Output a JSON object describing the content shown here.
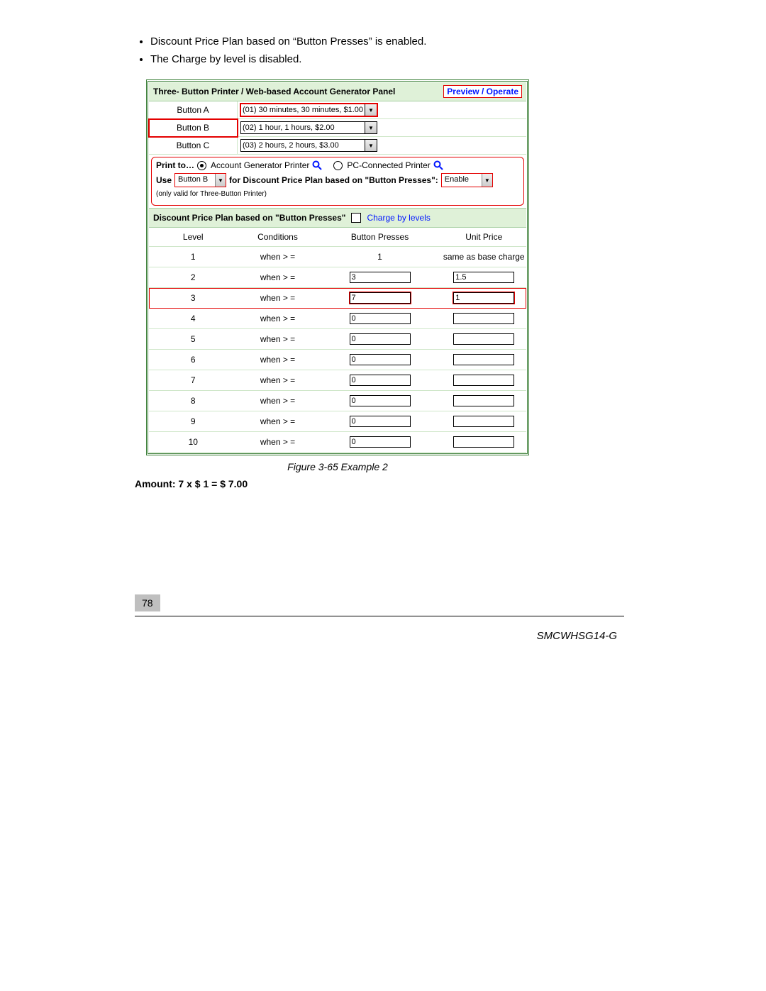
{
  "bullets": [
    "Discount Price Plan based on “Button Presses” is enabled.",
    "The Charge by level is disabled."
  ],
  "panel": {
    "title": "Three- Button Printer / Web-based Account Generator Panel",
    "preview_label": "Preview / Operate",
    "buttons": {
      "a_label": "Button A",
      "a_value": "(01) 30 minutes, 30 minutes, $1.00",
      "b_label": "Button B",
      "b_value": "(02) 1 hour, 1 hours, $2.00",
      "c_label": "Button C",
      "c_value": "(03) 2 hours, 2 hours, $3.00"
    },
    "print_to_label": "Print to…",
    "radio_acct": "Account Generator Printer",
    "radio_pc": "PC-Connected Printer",
    "use_label": "Use",
    "use_value": "Button B",
    "for_label": "for Discount Price Plan based on \"Button Presses\":",
    "enable_value": "Enable",
    "valid_note": "(only valid for Three-Button Printer)"
  },
  "discount": {
    "title": "Discount Price Plan based on \"Button Presses\"",
    "charge_label": "Charge by levels",
    "head_level": "Level",
    "head_cond": "Conditions",
    "head_bp": "Button Presses",
    "head_up": "Unit Price",
    "rows": [
      {
        "level": "1",
        "cond": "when > =",
        "bp_text": "1",
        "up_text": "same as base charge",
        "plain": true
      },
      {
        "level": "2",
        "cond": "when > =",
        "bp": "3",
        "up": "1.5"
      },
      {
        "level": "3",
        "cond": "when > =",
        "bp": "7",
        "up": "1",
        "highlight": true
      },
      {
        "level": "4",
        "cond": "when > =",
        "bp": "0",
        "up": ""
      },
      {
        "level": "5",
        "cond": "when > =",
        "bp": "0",
        "up": ""
      },
      {
        "level": "6",
        "cond": "when > =",
        "bp": "0",
        "up": ""
      },
      {
        "level": "7",
        "cond": "when > =",
        "bp": "0",
        "up": ""
      },
      {
        "level": "8",
        "cond": "when > =",
        "bp": "0",
        "up": ""
      },
      {
        "level": "9",
        "cond": "when > =",
        "bp": "0",
        "up": ""
      },
      {
        "level": "10",
        "cond": "when > =",
        "bp": "0",
        "up": ""
      }
    ]
  },
  "figure_caption": "Figure 3-65 Example 2",
  "amount_line": "Amount: 7 x $ 1 = $ 7.00",
  "page_number": "78",
  "model": "SMCWHSG14-G"
}
